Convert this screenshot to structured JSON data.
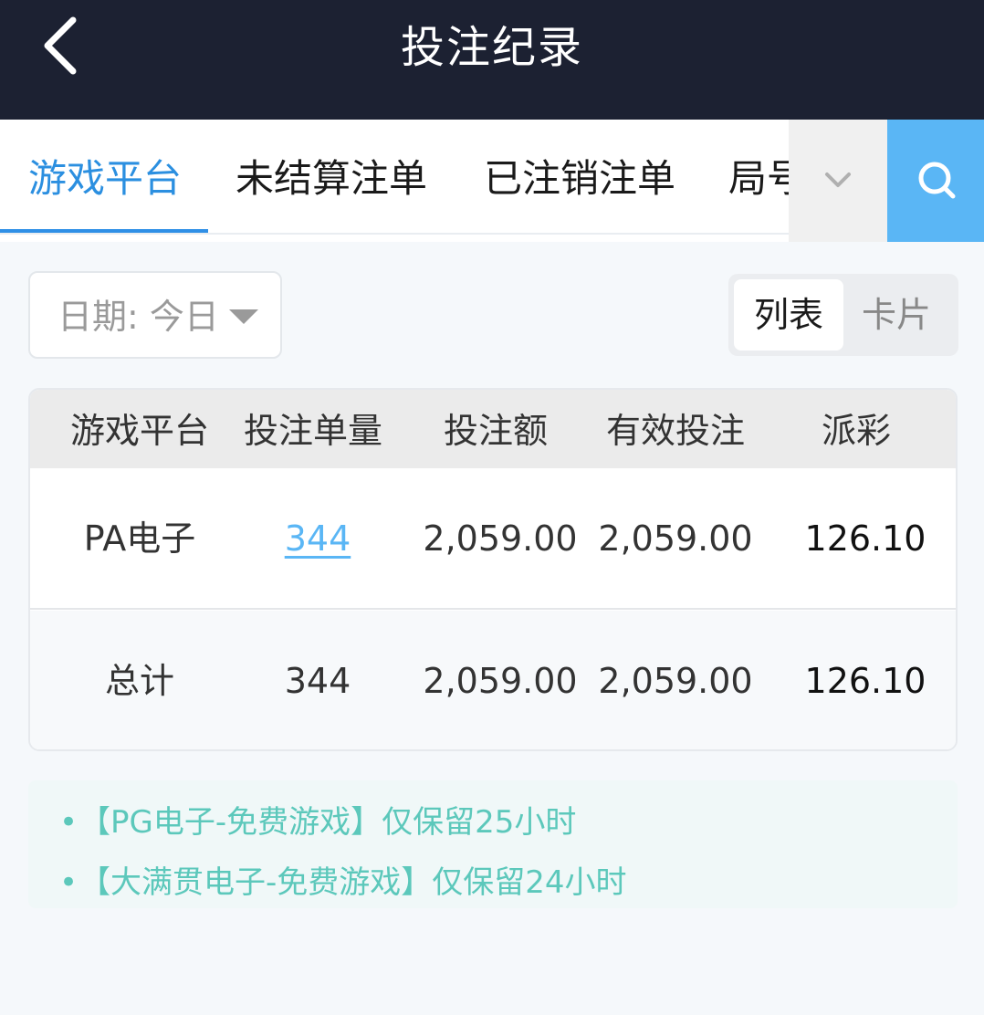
{
  "header": {
    "title": "投注纪录",
    "back_icon": "chevron-left-icon"
  },
  "tabs": [
    {
      "label": "游戏平台",
      "active": true
    },
    {
      "label": "未结算注单",
      "active": false
    },
    {
      "label": "已注销注单",
      "active": false
    },
    {
      "label": "局号",
      "active": false
    }
  ],
  "tabbar_icons": {
    "more": "chevron-down-icon",
    "search": "search-icon"
  },
  "filter": {
    "date_label": "日期: 今日"
  },
  "view_toggle": {
    "list": "列表",
    "card": "卡片",
    "selected": "列表"
  },
  "table": {
    "headers": [
      "游戏平台",
      "投注单量",
      "投注额",
      "有效投注",
      "派彩"
    ],
    "rows": [
      {
        "platform": "PA电子",
        "count": "344",
        "amount": "2,059.00",
        "valid": "2,059.00",
        "payout": "126.10"
      }
    ],
    "total": {
      "label": "总计",
      "count": "344",
      "amount": "2,059.00",
      "valid": "2,059.00",
      "payout": "126.10"
    }
  },
  "notices": [
    "【PG电子-免费游戏】仅保留25小时",
    "【大满贯电子-免费游戏】仅保留24小时"
  ],
  "colors": {
    "header_bg": "#1c2132",
    "accent_blue": "#2b8fe0",
    "search_bg": "#5ab6f5",
    "notice_text": "#5cc8bb"
  }
}
